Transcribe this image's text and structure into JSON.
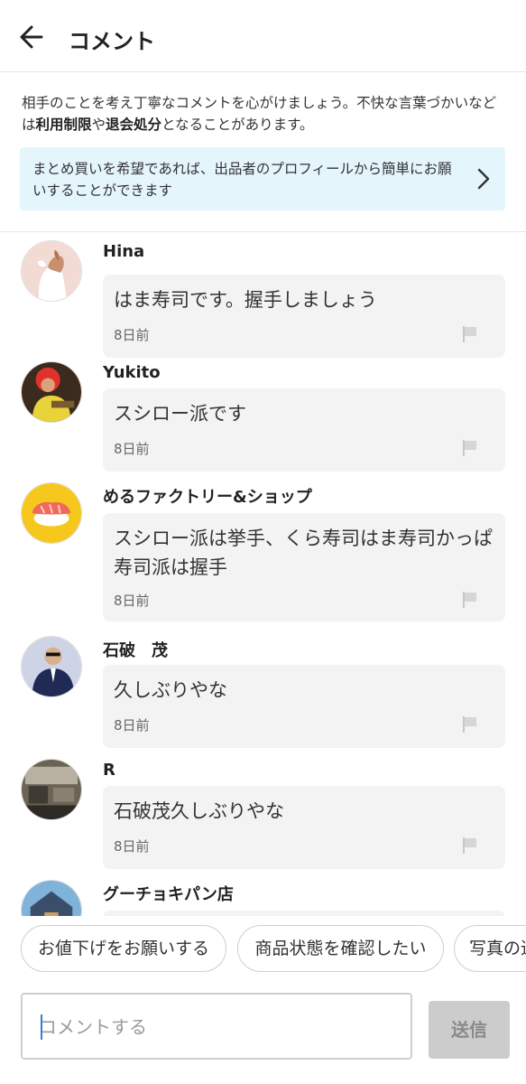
{
  "header": {
    "title": "コメント",
    "back_icon": "arrow-left-icon"
  },
  "notice": {
    "part1": "相手のことを考え丁寧なコメントを心がけましょう。不快な言葉づかいなどは",
    "bold1": "利用制限",
    "part2": "や",
    "bold2": "退会処分",
    "part3": "となることがあります。"
  },
  "banner": {
    "text": "まとめ買いを希望であれば、出品者のプロフィールから簡単にお願いすることができます",
    "icon": "chevron-right-icon",
    "background": "#e4f5fc"
  },
  "comments": [
    {
      "name": "Hina",
      "text": "はま寿司です。握手しましょう",
      "time": "8日前"
    },
    {
      "name": "Yukito",
      "text": "スシロー派です",
      "time": "8日前"
    },
    {
      "name": "めるファクトリー&ショップ",
      "text": "スシロー派は挙手、くら寿司はま寿司かっぱ寿司派は握手",
      "time": "8日前"
    },
    {
      "name": "石破　茂",
      "text": "久しぶりやな",
      "time": "8日前"
    },
    {
      "name": "R",
      "text": "石破茂久しぶりやな",
      "time": "8日前"
    },
    {
      "name": "グーチョキパン店",
      "text": "",
      "time": ""
    }
  ],
  "quick_replies": [
    "お値下げをお願いする",
    "商品状態を確認したい",
    "写真の追"
  ],
  "input": {
    "placeholder": "コメントする",
    "value": ""
  },
  "send_button": {
    "label": "送信",
    "background": "#cccccc"
  }
}
